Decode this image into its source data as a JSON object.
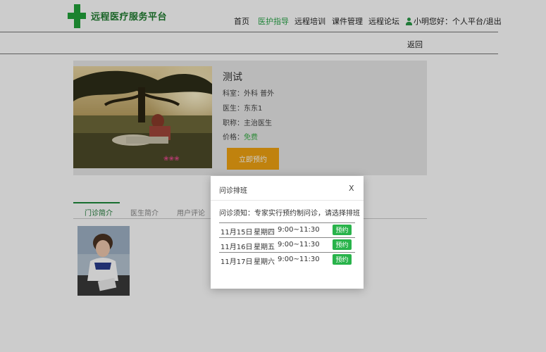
{
  "header": {
    "site_title": "远程医疗服务平台",
    "nav": [
      "首页",
      "医护指导",
      "远程培训",
      "课件管理",
      "远程论坛"
    ],
    "user_text": "小明您好：个人平台/退出"
  },
  "subbar": {
    "back": "返回"
  },
  "course": {
    "name": "测试",
    "department": "科室：外科  普外",
    "doctor": "医生：东东1",
    "title": "职称：主治医生",
    "price_label": "价格：",
    "price_value": "免费",
    "book_button": "立即预约"
  },
  "tabs": [
    "门诊简介",
    "医生简介",
    "用户评论"
  ],
  "modal": {
    "title": "问诊排班",
    "close": "X",
    "notice": "问诊须知：专家实行预约制问诊，请选择排班",
    "slots": [
      {
        "date": "11月15日",
        "day": "星期四",
        "time": "9:00~11:30",
        "action": "预约"
      },
      {
        "date": "11月16日",
        "day": "星期五",
        "time": "9:00~11:30",
        "action": "预约"
      },
      {
        "date": "11月17日",
        "day": "星期六",
        "time": "9:00~11:30",
        "action": "预约"
      }
    ]
  },
  "colors": {
    "brand_green": "#21a33a",
    "active_nav": "#2ea84d",
    "book_orange": "#f0a312",
    "reserve_green": "#28b34a"
  },
  "icons": {
    "logo": "green-cross-icon",
    "user": "user-icon"
  }
}
